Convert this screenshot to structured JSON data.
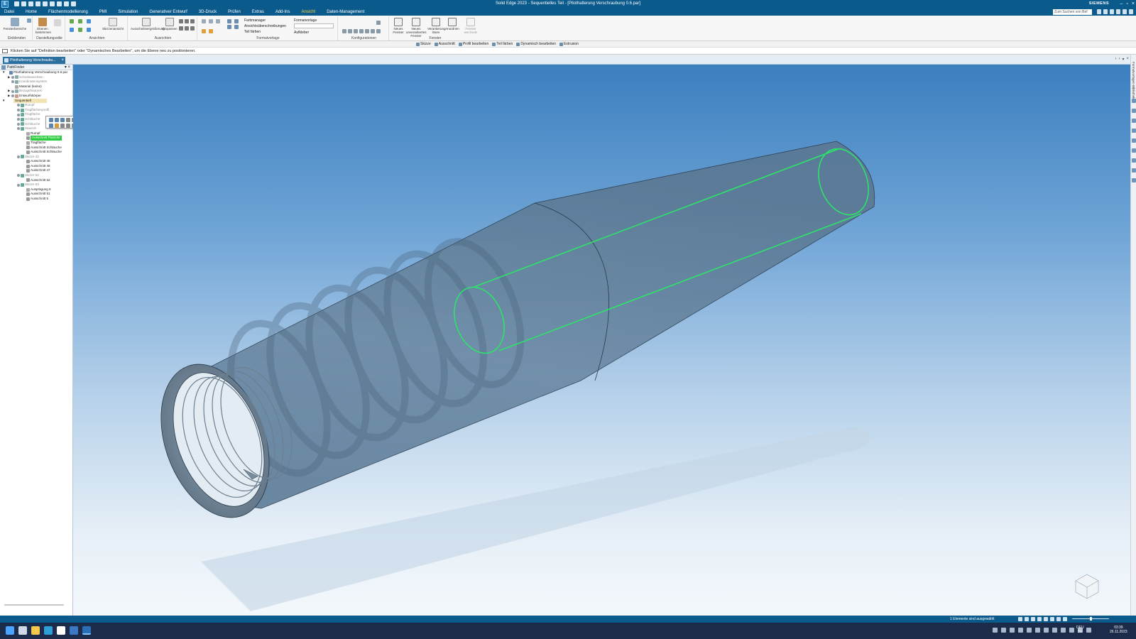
{
  "window": {
    "title": "Solid Edge 2023 - Sequentielles Teil - [Pitothalterung Verschraubung 0.6.par]",
    "brand": "SIEMENS",
    "buttons": [
      "–",
      "▫",
      "×"
    ]
  },
  "menu": {
    "tabs": [
      "Datei",
      "Home",
      "Flächenmodellierung",
      "PMI",
      "Simulation",
      "Generativer Entwurf",
      "3D-Druck",
      "Prüfen",
      "Extras",
      "Add-Ins",
      "Ansicht",
      "Daten-Management"
    ],
    "active": "Ansicht",
    "search_placeholder": "Zum Suchen von Bef"
  },
  "ribbon": {
    "groups": {
      "einblenden": "Einblenden",
      "darstellungsstile": "Darstellungsstile",
      "ansichten": "Ansichten",
      "ausrichten": "Ausrichten",
      "formatvorlage": "Formatvorlage",
      "konfigurationen": "Konfigurationen",
      "fenster": "Fenster"
    },
    "buttons": {
      "fensterbereiche": "Fensterbereiche",
      "ebenen_bestimmen": "Ebenen bestimmen",
      "skizzenansicht": "Skizzenansicht",
      "ausschnittsvergroesserung": "Ausschnittvergrößerung",
      "einpassen": "Einpassen",
      "neues_fenster": "Neues Fenster",
      "neues_unverankertes_fenster": "Neues unverankertes Fenster",
      "verankerung_loesen": "Verankerung lösen",
      "anordnen": "Anordnen",
      "fenster_wechseln": "Fenster wechseln"
    },
    "format": {
      "farbmanager": "Farbmanager",
      "ansichtsueberschreibungen": "Ansichtsüberschreibungen",
      "teil_faerben": "Teil färben",
      "formatvorlage": "Formatvorlage",
      "aufkleber": "Aufkleber"
    }
  },
  "command_bar": [
    "Skizze",
    "Ausschnitt",
    "Profil bearbeiten",
    "Teil färben",
    "Dynamisch bearbeiten",
    "Extrusion"
  ],
  "prompt": "Klicken Sie auf \"Definition bearbeiten\" oder \"Dynamisches Bearbeiten\", um die Ebene neu zu positionieren.",
  "document_tab": "Pitothalterung Verschraubu...",
  "pathfinder": {
    "title": "PathFinder",
    "items": [
      {
        "label": "Pitothalterung Verschraubung 0.6.par",
        "style": "normal"
      },
      {
        "label": "Schnittansichten",
        "style": "gray"
      },
      {
        "label": "Koordinatensystem",
        "style": "gray"
      },
      {
        "label": "Material (keine)",
        "style": "normal"
      },
      {
        "label": "Bezugsfeatures",
        "style": "gray"
      },
      {
        "label": "Entwurfskörper",
        "style": "normal"
      },
      {
        "label": "Sequentiell",
        "style": "hl"
      },
      {
        "label": "Rumpf",
        "style": "gray"
      },
      {
        "label": "Tragflächenprofil",
        "style": "gray"
      },
      {
        "label": "Tragfläche",
        "style": "gray"
      },
      {
        "label": "Schläuche",
        "style": "gray"
      },
      {
        "label": "Schläuche",
        "style": "gray"
      },
      {
        "label": "Stauroh",
        "style": "gray"
      },
      {
        "label": "Rumpf",
        "style": "normal"
      },
      {
        "label": "Ausschnitt Pitotrohr",
        "style": "sel"
      },
      {
        "label": "Tragfläche",
        "style": "normal"
      },
      {
        "label": "Ausschnitt Schläuche",
        "style": "normal"
      },
      {
        "label": "Ausschnitt Schläuche",
        "style": "normal"
      },
      {
        "label": "Skizze 42",
        "style": "gray"
      },
      {
        "label": "Ausschnitt 45",
        "style": "normal"
      },
      {
        "label": "Ausschnitt 46",
        "style": "normal"
      },
      {
        "label": "Ausschnitt 47",
        "style": "normal"
      },
      {
        "label": "Skizze 52",
        "style": "gray"
      },
      {
        "label": "Ausschnitt 52",
        "style": "normal"
      },
      {
        "label": "Skizze 53",
        "style": "gray"
      },
      {
        "label": "Ausprägung 8",
        "style": "normal"
      },
      {
        "label": "Ausschnitt 51",
        "style": "normal"
      },
      {
        "label": "Ausschnitt 5",
        "style": "normal"
      }
    ]
  },
  "right_panel_label": "Formatvorlagen-Bibliothek",
  "status": {
    "text": "1 Elemente sind ausgewählt"
  },
  "taskbar": {
    "lang_top": "DEU",
    "lang_bottom": "DE",
    "time": "03:39",
    "date": "26.11.2023"
  },
  "colors": {
    "title_bar": "#0b5a8c",
    "active_tab": "#f5d442",
    "selection": "#2ecc40",
    "highlight_edge": "#2ee36a",
    "part_body": "#5b7c99"
  }
}
